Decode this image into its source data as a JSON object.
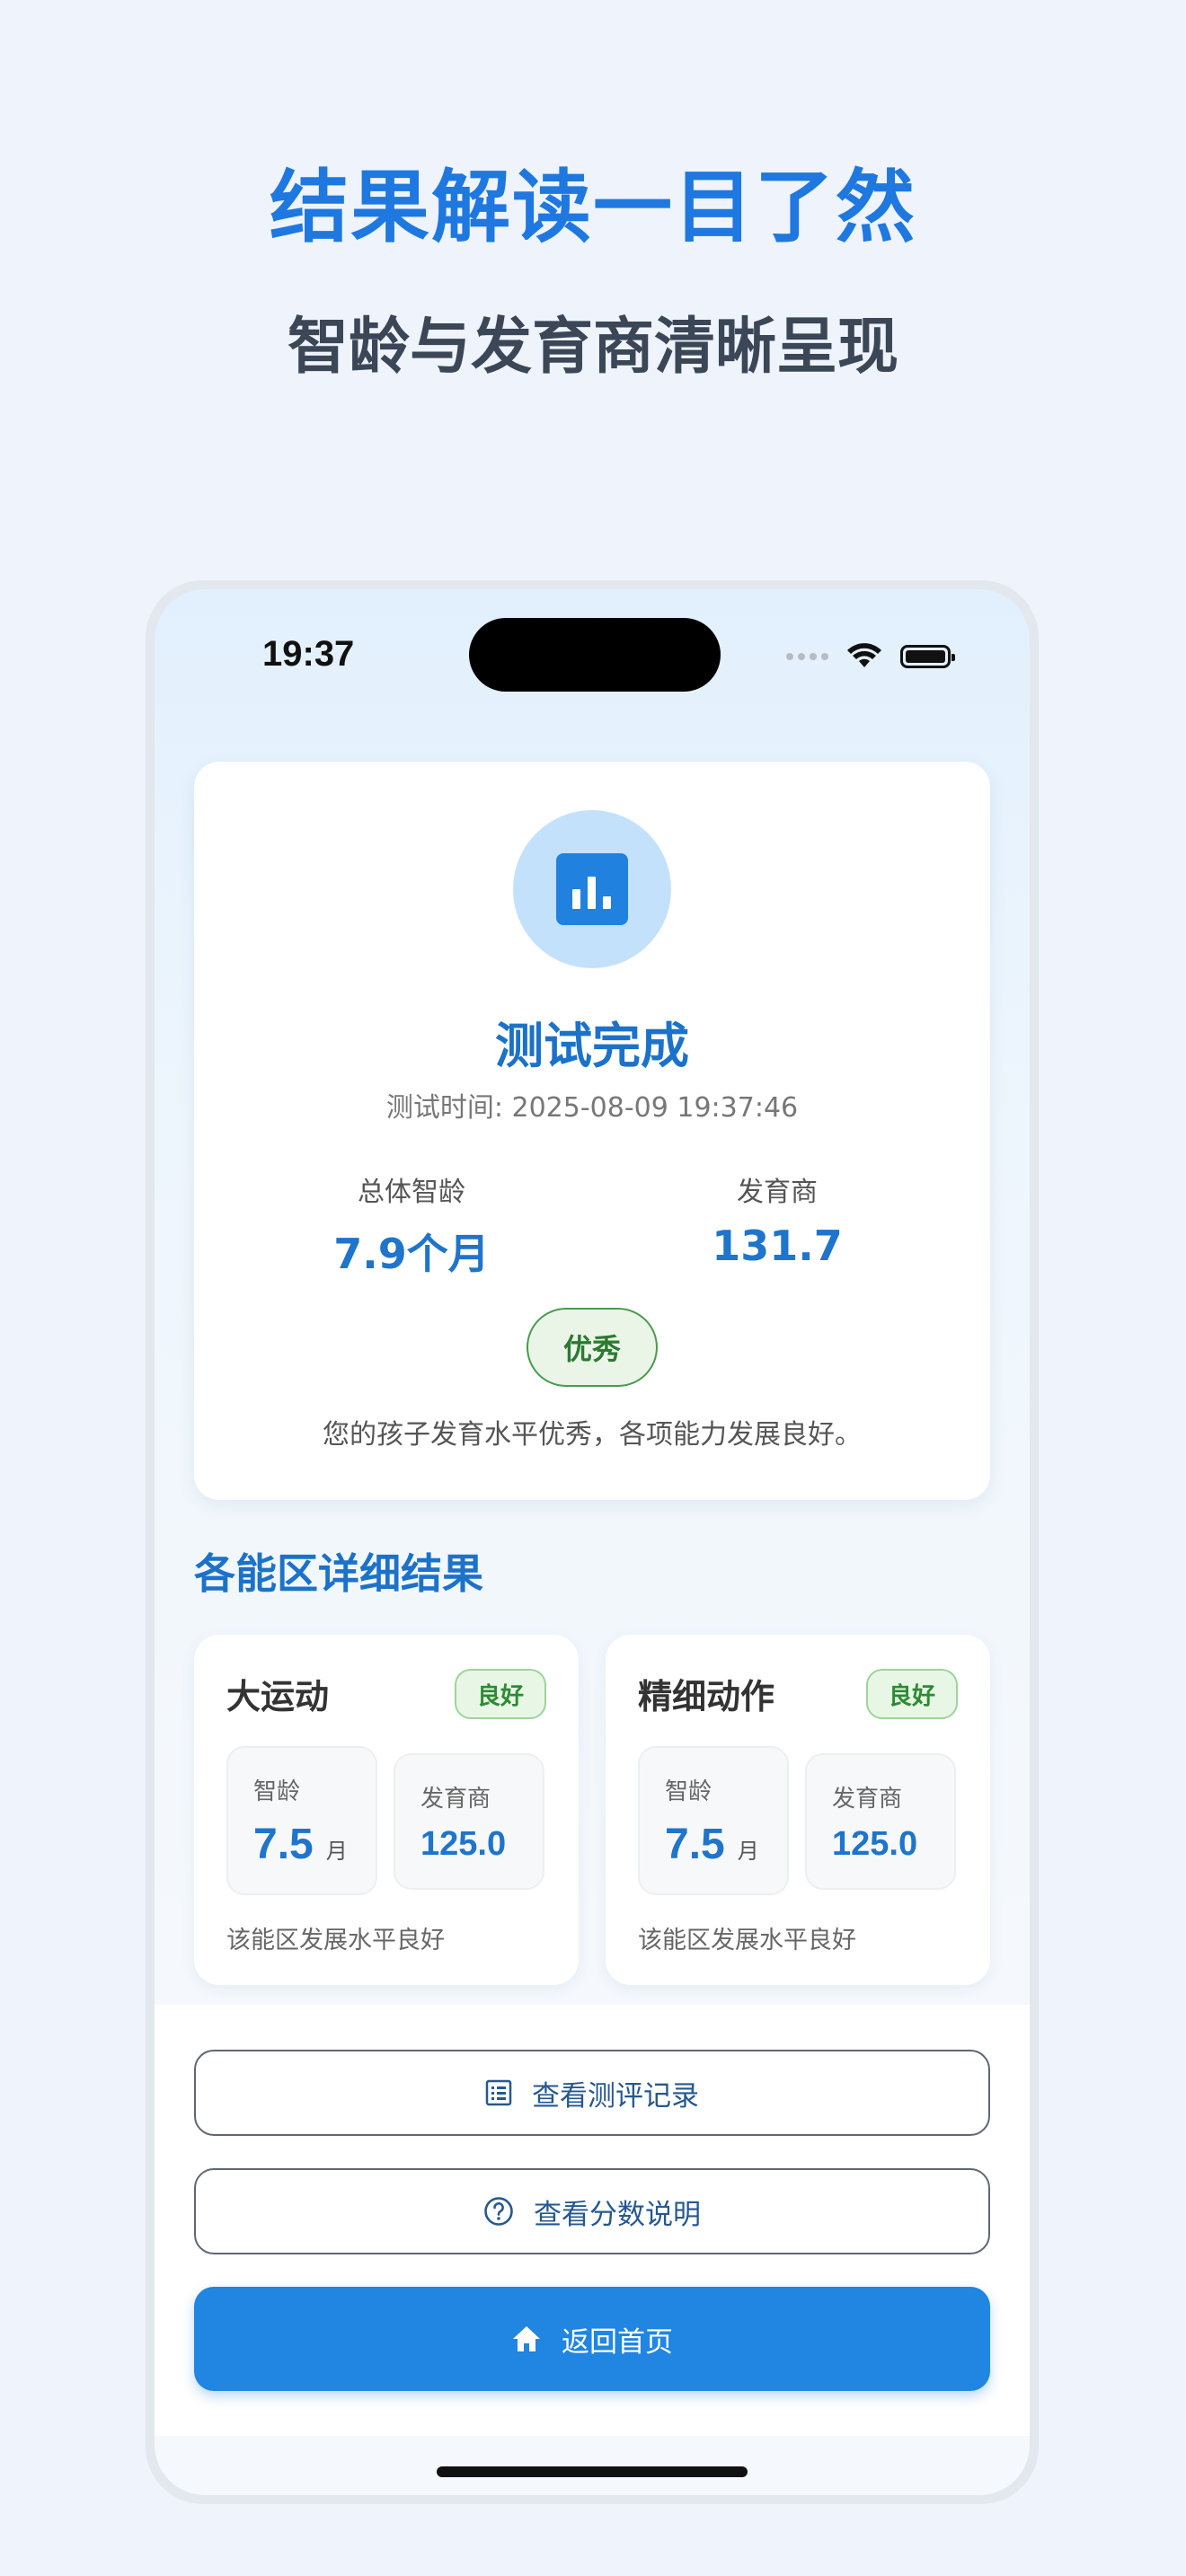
{
  "promo": {
    "headline": "结果解读一目了然",
    "subline": "智龄与发育商清晰呈现"
  },
  "status_bar": {
    "time": "19:37"
  },
  "result": {
    "title": "测试完成",
    "test_time": "测试时间: 2025-08-09 19:37:46",
    "overall_age_label": "总体智龄",
    "overall_age_value": "7.9个月",
    "dq_label": "发育商",
    "dq_value": "131.7",
    "level_badge": "优秀",
    "summary": "您的孩子发育水平优秀，各项能力发展良好。"
  },
  "areas_section_title": "各能区详细结果",
  "areas": [
    {
      "name": "大运动",
      "badge": "良好",
      "age_label": "智龄",
      "age_value": "7.5",
      "age_unit": "月",
      "dq_label": "发育商",
      "dq_value": "125.0",
      "desc": "该能区发展水平良好"
    },
    {
      "name": "精细动作",
      "badge": "良好",
      "age_label": "智龄",
      "age_value": "7.5",
      "age_unit": "月",
      "dq_label": "发育商",
      "dq_value": "125.0",
      "desc": "该能区发展水平良好"
    }
  ],
  "actions": {
    "history_label": "查看测评记录",
    "score_help_label": "查看分数说明",
    "home_label": "返回首页"
  },
  "colors": {
    "accent": "#1e78e0",
    "primary_button": "#2185e2",
    "success": "#2e8a34"
  },
  "icons": {
    "chart": "bar-chart-icon",
    "history": "list-icon",
    "help": "question-circle-icon",
    "home": "home-icon"
  }
}
